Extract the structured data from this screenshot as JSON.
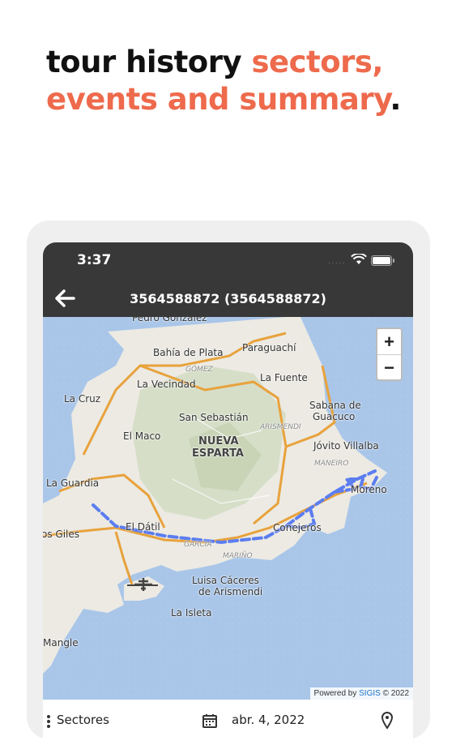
{
  "headline": {
    "part1": "tour history ",
    "part2": "sectors,",
    "part3": "events and summary",
    "part4": "."
  },
  "colors": {
    "accent": "#ee6a4c",
    "bar": "#383838",
    "route": "#5b7df0"
  },
  "status": {
    "time": "3:37",
    "signal": "·····"
  },
  "appbar": {
    "title": "3564588872 (3564588872)",
    "back_icon": "back-arrow-icon"
  },
  "map": {
    "zoom_in": "+",
    "zoom_out": "−",
    "attribution_prefix": "Powered by ",
    "attribution_brand": "SIGIS",
    "attribution_suffix": " © 2022",
    "places": {
      "pedro_gonzalez": "Pedro González",
      "bahia_de_plata": "Bahía de Plata",
      "paraguachi": "Paraguachí",
      "gomez": "GÓMEZ",
      "la_vecindad": "La Vecindad",
      "la_fuente": "La Fuente",
      "la_cruz": "La Cruz",
      "sabana_de": "Sabana de",
      "guacuco": "Guacuco",
      "san_sebastian": "San Sebastián",
      "arismendi": "ARISMENDI",
      "el_maco": "El Maco",
      "nueva": "NUEVA",
      "esparta": "ESPARTA",
      "jovito_villalba": "Jóvito Villalba",
      "maneiro": "MANEIRO",
      "la_guardia": "La Guardia",
      "moreno": "Moreno",
      "el_datil": "El Dátil",
      "conejeros": "Conejeros",
      "los_giles": "os Giles",
      "garcia": "GARCÍA",
      "marino": "MARIÑO",
      "luisa1": "Luisa Cáceres",
      "luisa2": "de Arismendi",
      "la_isleta": "La Isleta",
      "mangle": "Mangle"
    }
  },
  "bottom": {
    "sectors_label": "Sectores",
    "date_label": "abr. 4, 2022"
  }
}
